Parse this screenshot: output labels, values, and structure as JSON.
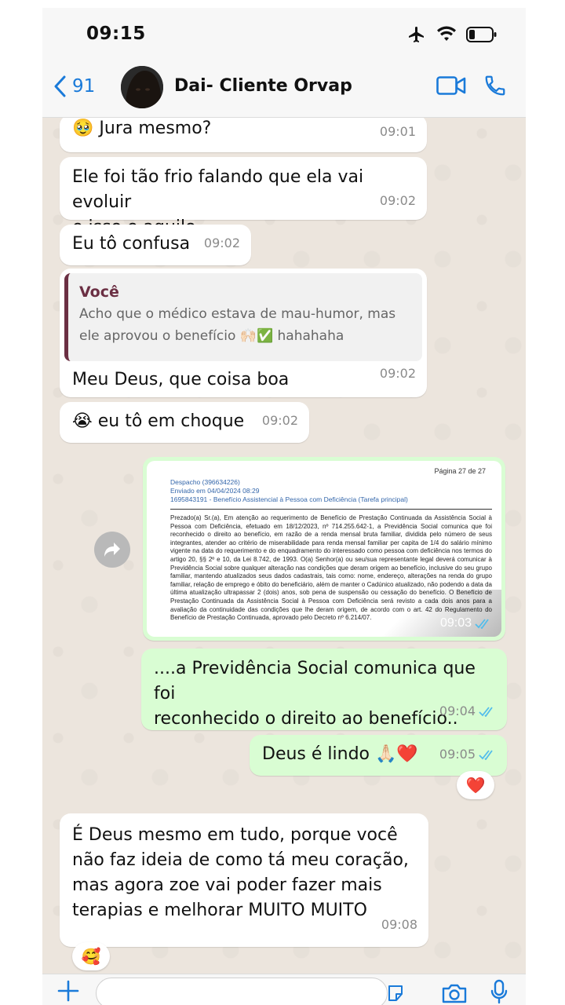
{
  "status_bar": {
    "time": "09:15"
  },
  "header": {
    "back_count": "91",
    "contact_name": "Dai- Cliente Orvap"
  },
  "messages": [
    {
      "emoji": "🥹",
      "text": "Jura mesmo?",
      "time": "09:01"
    },
    {
      "text_line1": "Ele foi tão frio falando que ela vai evoluir",
      "text_line2": "e isso e aquilo",
      "time": "09:02"
    },
    {
      "text": "Eu tô confusa",
      "time": "09:02"
    },
    {
      "quote_author": "Você",
      "quote_line1": "Acho que o médico estava de mau-humor, mas",
      "quote_line2": "ele aprovou o benefício 🙌🏻✅ hahahaha",
      "text": "Meu Deus, que coisa boa",
      "time": "09:02"
    },
    {
      "emoji": "😭",
      "text": "eu tô em choque",
      "time": "09:02"
    },
    {
      "time": "09:03",
      "doc": {
        "page": "Página 27 de 27",
        "header_line1": "Despacho (396634226)",
        "header_line2": "Enviado em 04/04/2024 08:29",
        "header_line3": "1695843191 - Benefício Assistencial à Pessoa com Deficiência (Tarefa principal)",
        "body": "Prezado(a) Sr.(a),   Em atenção ao requerimento de Benefício de Prestação Continuada da Assistência Social à Pessoa com Deficiência, efetuado em 18/12/2023, nº 714.255.642-1, a Previdência Social comunica que foi reconhecido o direito ao benefício, em razão de a renda mensal bruta familiar, dividida pelo número de seus integrantes, atender ao critério de miserabilidade para renda mensal familiar per capita de 1/4 do salário mínimo vigente na data do requerimento e do enquadramento do interessado como pessoa com deficiência nos termos do artigo 20, §§ 2º e 10, da Lei 8.742, de 1993.   O(a) Senhor(a) ou seu/sua representante legal deverá comunicar à Previdência Social sobre qualquer alteração nas condições que deram origem ao benefício, inclusive do seu grupo familiar, mantendo atualizados seus dados cadastrais, tais como: nome, endereço, alterações na renda do grupo familiar, relação de emprego e óbito do beneficiário, além de manter o Cadúnico atualizado, não podendo a data da última atualização ultrapassar 2 (dois) anos, sob pena de suspensão ou cessação do benefício.   O Benefício de Prestação Continuada da Assistência Social à Pessoa com Deficiência será revisto a cada dois anos para a avaliação da continuidade das condições que lhe deram origem, de acordo com o art. 42 do Regulamento do Benefício de Prestação Continuada, aprovado pelo Decreto nº 6.214/07."
      }
    },
    {
      "text_line1": "....a Previdência Social comunica que foi",
      "text_line2": "reconhecido o direito ao benefício..",
      "time": "09:04"
    },
    {
      "text": "Deus é lindo 🙏🏻❤️",
      "time": "09:05",
      "reaction": "❤️"
    },
    {
      "text_line1": "É Deus mesmo em tudo, porque você",
      "text_line2": "não faz ideia de como tá meu coração,",
      "text_line3": "mas agora zoe vai poder fazer mais",
      "text_line4": "terapias e melhorar MUITO MUITO",
      "time": "09:08",
      "reaction": "🥰"
    }
  ],
  "input": {
    "placeholder": ""
  },
  "colors": {
    "accent": "#1a7ad9",
    "outgoing": "#d9fdd3",
    "incoming": "#ffffff",
    "quote_bar": "#6b2f43",
    "read_tick": "#53bdeb"
  }
}
